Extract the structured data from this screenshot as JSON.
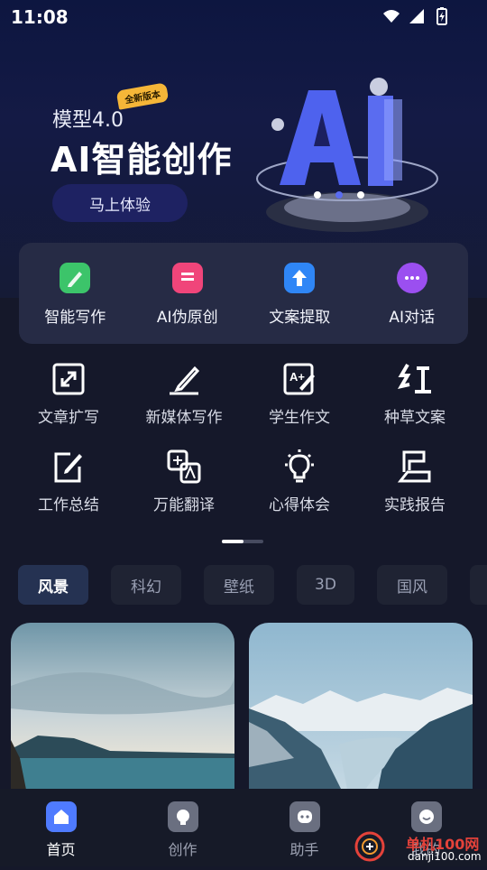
{
  "status_bar": {
    "time": "11:08"
  },
  "banner": {
    "model_label": "模型4.0",
    "badge": "全新版本",
    "title": "AI智能创作",
    "cta": "马上体验"
  },
  "quick_actions": [
    {
      "label": "智能写作",
      "icon": "pen-note-icon",
      "color": "#3cc46a"
    },
    {
      "label": "AI伪原创",
      "icon": "pages-icon",
      "color": "#f0457a"
    },
    {
      "label": "文案提取",
      "icon": "upload-arrow-icon",
      "color": "#2f86f6"
    },
    {
      "label": "AI对话",
      "icon": "chat-bubble-icon",
      "color": "#9b4ff0"
    }
  ],
  "tools": [
    {
      "label": "文章扩写",
      "icon": "expand-icon"
    },
    {
      "label": "新媒体写作",
      "icon": "pen-writing-icon"
    },
    {
      "label": "学生作文",
      "icon": "a-plus-edit-icon"
    },
    {
      "label": "种草文案",
      "icon": "hong-character-icon"
    },
    {
      "label": "工作总结",
      "icon": "report-edit-icon"
    },
    {
      "label": "万能翻译",
      "icon": "translate-icon"
    },
    {
      "label": "心得体会",
      "icon": "lightbulb-icon"
    },
    {
      "label": "实践报告",
      "icon": "flag-icon"
    }
  ],
  "categories": [
    {
      "label": "风景",
      "active": true
    },
    {
      "label": "科幻",
      "active": false
    },
    {
      "label": "壁纸",
      "active": false
    },
    {
      "label": "3D",
      "active": false
    },
    {
      "label": "国风",
      "active": false
    },
    {
      "label": "",
      "active": false
    }
  ],
  "bottom_nav": [
    {
      "label": "首页",
      "icon": "home-icon",
      "active": true
    },
    {
      "label": "创作",
      "icon": "bulb-icon",
      "active": false
    },
    {
      "label": "助手",
      "icon": "robot-icon",
      "active": false
    },
    {
      "label": "我的",
      "icon": "profile-icon",
      "active": false
    }
  ],
  "watermark": {
    "text": "单机100网",
    "url": "danji100.com"
  }
}
